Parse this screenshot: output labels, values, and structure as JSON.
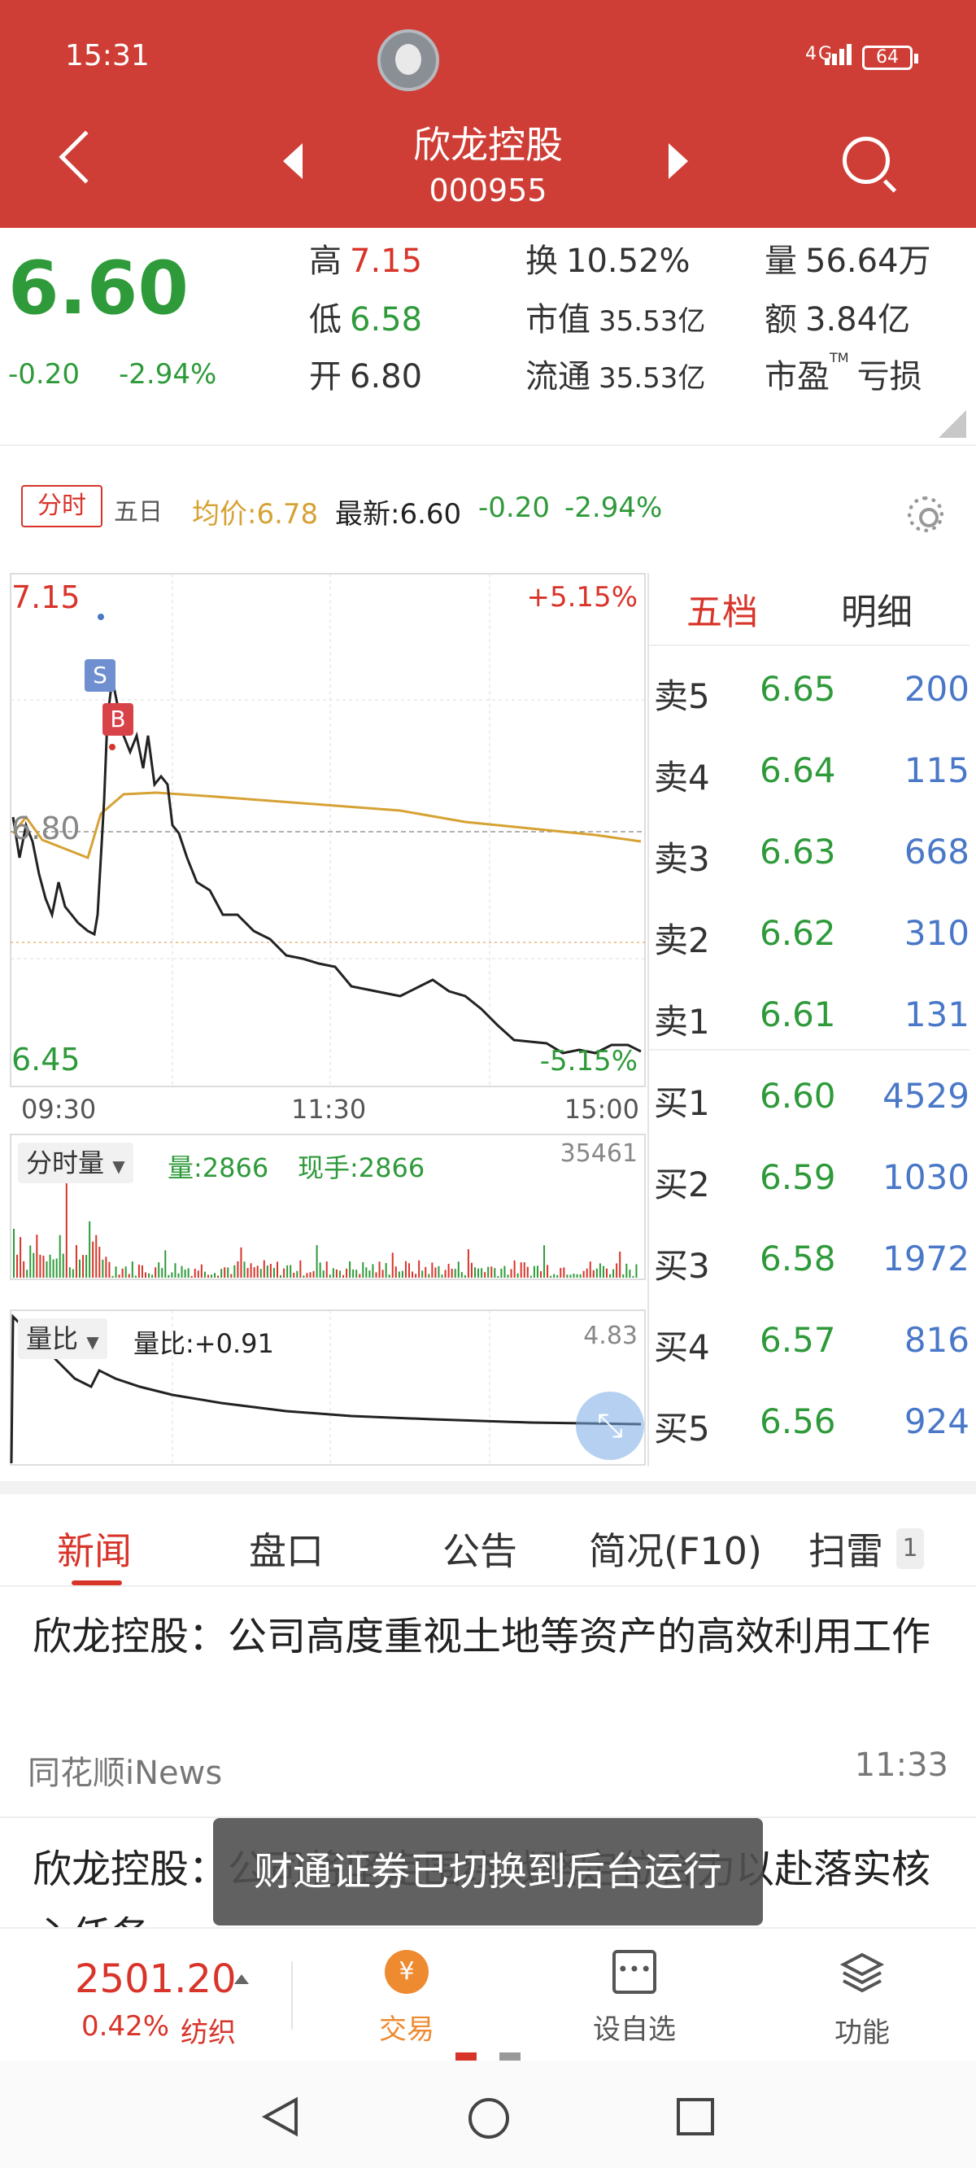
{
  "status_bar": {
    "time": "15:31",
    "network": "4G",
    "battery": "64"
  },
  "header": {
    "name": "欣龙控股",
    "code": "000955"
  },
  "quote": {
    "price": "6.60",
    "change": "-0.20",
    "change_pct": "-2.94%",
    "fields": [
      {
        "label": "高",
        "value": "7.15",
        "color": "red"
      },
      {
        "label": "低",
        "value": "6.58",
        "color": "green"
      },
      {
        "label": "开",
        "value": "6.80",
        "color": "plain"
      },
      {
        "label": "换",
        "value": "10.52%",
        "color": "plain"
      },
      {
        "label": "市值",
        "value": "35.53亿",
        "color": "plain"
      },
      {
        "label": "流通",
        "value": "35.53亿",
        "color": "plain"
      },
      {
        "label": "量",
        "value": "56.64万",
        "color": "plain"
      },
      {
        "label": "额",
        "value": "3.84亿",
        "color": "plain"
      },
      {
        "label": "市盈",
        "tm": "TM",
        "value": "亏损",
        "color": "plain"
      }
    ]
  },
  "time_tabs": {
    "active": "分时",
    "other": "五日",
    "avg": "均价:6.78",
    "latest": "最新:6.60",
    "latest_change": "-0.20",
    "latest_pct": "-2.94%"
  },
  "chart_data": [
    {
      "type": "line",
      "x": [
        "09:30",
        "11:30",
        "15:00"
      ],
      "y_max": "7.15",
      "y_min": "6.45",
      "y_ref": "6.80",
      "pct_max": "+5.15%",
      "pct_min": "-5.15%",
      "series": [],
      "markers": [
        "S",
        "B"
      ]
    },
    {
      "type": "bar",
      "label": "分时量",
      "vol": "量:2866",
      "hand": "现手:2866",
      "max": "35461"
    },
    {
      "type": "line",
      "label": "量比",
      "ratio": "量比:+0.91",
      "max": "4.83"
    }
  ],
  "order_book": {
    "tabs": [
      "五档",
      "明细"
    ],
    "asks": [
      {
        "label": "卖5",
        "price": "6.65",
        "vol": "200"
      },
      {
        "label": "卖4",
        "price": "6.64",
        "vol": "115"
      },
      {
        "label": "卖3",
        "price": "6.63",
        "vol": "668"
      },
      {
        "label": "卖2",
        "price": "6.62",
        "vol": "310"
      },
      {
        "label": "卖1",
        "price": "6.61",
        "vol": "131"
      }
    ],
    "bids": [
      {
        "label": "买1",
        "price": "6.60",
        "vol": "4529"
      },
      {
        "label": "买2",
        "price": "6.59",
        "vol": "1030"
      },
      {
        "label": "买3",
        "price": "6.58",
        "vol": "1972"
      },
      {
        "label": "买4",
        "price": "6.57",
        "vol": "816"
      },
      {
        "label": "买5",
        "price": "6.56",
        "vol": "924"
      }
    ]
  },
  "news_tabs": {
    "items": [
      "新闻",
      "盘口",
      "公告",
      "简况(F10)",
      "扫雷"
    ],
    "badge": "1"
  },
  "news": [
    {
      "title": "欣龙控股：公司高度重视土地等资产的高效利用工作",
      "source": "同花顺iNews",
      "time": "11:33"
    },
    {
      "title": "欣龙控股：公司将坚定围绕战略定位合力以赴落实核心任务"
    }
  ],
  "toast": "财通证券已切换到后台运行",
  "bottom_bar": {
    "index_value": "2501.20",
    "index_pct": "0.42%",
    "index_name": "纺织",
    "nav": [
      "交易",
      "设自选",
      "功能"
    ]
  },
  "colors": {
    "brand": "#cf3e36",
    "up": "#d8342a",
    "down": "#2e9a3a",
    "avg_line": "#d6a234",
    "vol_blue": "#4a78c8"
  },
  "icons": [
    "back-icon",
    "prev-arrow-icon",
    "next-arrow-icon",
    "search-icon",
    "settings-gear-icon",
    "expand-icon",
    "trade-icon",
    "add-watchlist-icon",
    "layers-icon",
    "nav-back-icon",
    "nav-home-icon",
    "nav-recent-icon"
  ]
}
